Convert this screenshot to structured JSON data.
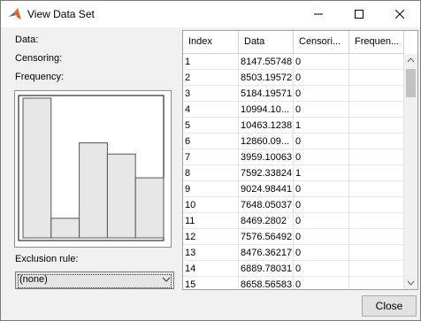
{
  "window": {
    "title": "View Data Set"
  },
  "labels": {
    "data": "Data:",
    "censoring": "Censoring:",
    "frequency": "Frequency:"
  },
  "histogram": {
    "bar_heights_relative": [
      1.0,
      0.14,
      0.68,
      0.6,
      0.43
    ]
  },
  "exclusion": {
    "label": "Exclusion rule:",
    "selected": "(none)"
  },
  "table": {
    "columns": [
      "Index",
      "Data",
      "Censori...",
      "Frequen..."
    ],
    "rows": [
      [
        "1",
        "8147.55748",
        "0",
        ""
      ],
      [
        "2",
        "8503.19572",
        "0",
        ""
      ],
      [
        "3",
        "5184.19571",
        "0",
        ""
      ],
      [
        "4",
        "10994.10...",
        "0",
        ""
      ],
      [
        "5",
        "10463.1238",
        "1",
        ""
      ],
      [
        "6",
        "12860.09...",
        "0",
        ""
      ],
      [
        "7",
        "3959.10063",
        "0",
        ""
      ],
      [
        "8",
        "7592.33824",
        "1",
        ""
      ],
      [
        "9",
        "9024.98441",
        "0",
        ""
      ],
      [
        "10",
        "7648.05037",
        "0",
        ""
      ],
      [
        "11",
        "8469.2802",
        "0",
        ""
      ],
      [
        "12",
        "7576.56492",
        "0",
        ""
      ],
      [
        "13",
        "8476.36217",
        "0",
        ""
      ],
      [
        "14",
        "6889.78031",
        "0",
        ""
      ],
      [
        "15",
        "8658.56583",
        "0",
        ""
      ]
    ]
  },
  "buttons": {
    "close": "Close"
  },
  "colors": {
    "bar_fill": "#e6e6e6",
    "bar_stroke": "#555555"
  }
}
